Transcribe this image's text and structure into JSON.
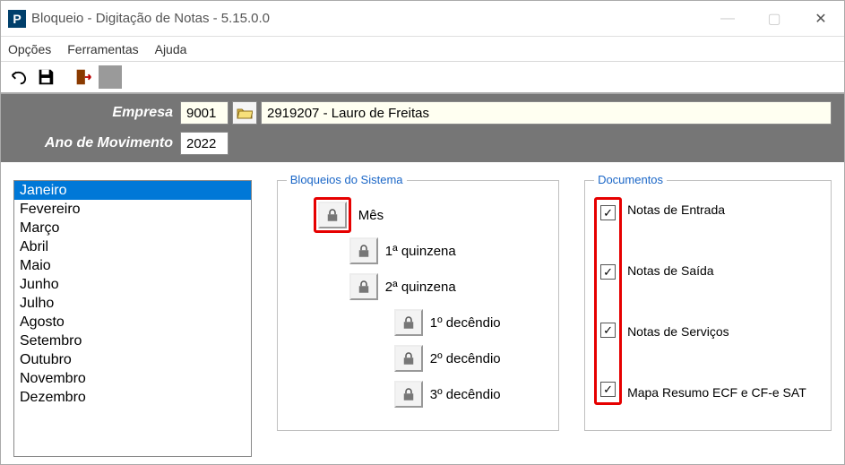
{
  "window": {
    "title": "Bloqueio - Digitação de Notas - 5.15.0.0"
  },
  "menu": [
    "Opções",
    "Ferramentas",
    "Ajuda"
  ],
  "params": {
    "empresa_label": "Empresa",
    "empresa_value": "9001",
    "empresa_desc": "2919207 - Lauro de Freitas",
    "ano_label": "Ano de Movimento",
    "ano_value": "2022"
  },
  "months": {
    "items": [
      "Janeiro",
      "Fevereiro",
      "Março",
      "Abril",
      "Maio",
      "Junho",
      "Julho",
      "Agosto",
      "Setembro",
      "Outubro",
      "Novembro",
      "Dezembro"
    ],
    "selected_index": 0
  },
  "bloqueios": {
    "legend": "Bloqueios do Sistema",
    "mes": "Mês",
    "q1": "1ª quinzena",
    "q2": "2ª quinzena",
    "d1": "1º decêndio",
    "d2": "2º decêndio",
    "d3": "3º decêndio"
  },
  "documentos": {
    "legend": "Documentos",
    "items": [
      {
        "label": "Notas de Entrada",
        "checked": true
      },
      {
        "label": "Notas de Saída",
        "checked": true
      },
      {
        "label": "Notas de Serviços",
        "checked": true
      },
      {
        "label": "Mapa Resumo ECF e CF-e SAT",
        "checked": true
      }
    ]
  }
}
